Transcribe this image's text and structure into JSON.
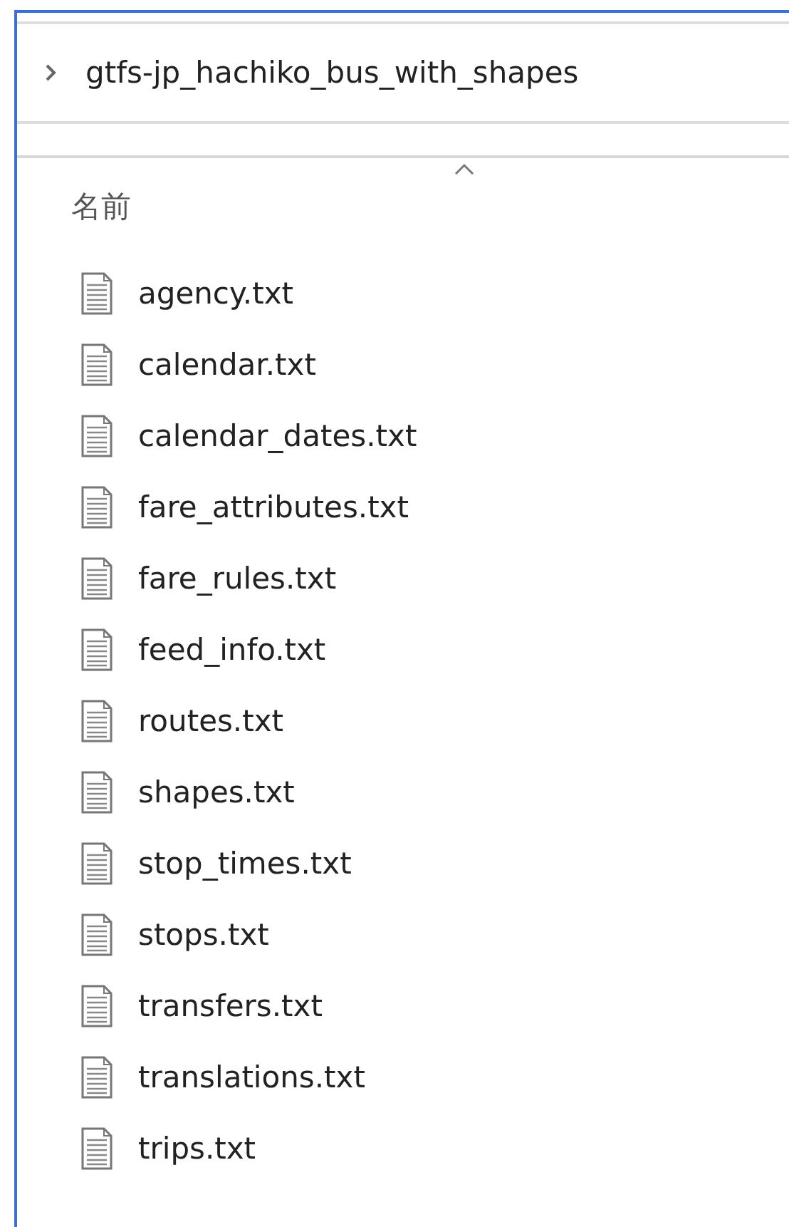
{
  "breadcrumb": {
    "label": "gtfs-jp_hachiko_bus_with_shapes"
  },
  "column_header": {
    "label": "名前",
    "sorted_ascending": true
  },
  "files": [
    {
      "name": "agency.txt"
    },
    {
      "name": "calendar.txt"
    },
    {
      "name": "calendar_dates.txt"
    },
    {
      "name": "fare_attributes.txt"
    },
    {
      "name": "fare_rules.txt"
    },
    {
      "name": "feed_info.txt"
    },
    {
      "name": "routes.txt"
    },
    {
      "name": "shapes.txt"
    },
    {
      "name": "stop_times.txt"
    },
    {
      "name": "stops.txt"
    },
    {
      "name": "transfers.txt"
    },
    {
      "name": "translations.txt"
    },
    {
      "name": "trips.txt"
    }
  ]
}
